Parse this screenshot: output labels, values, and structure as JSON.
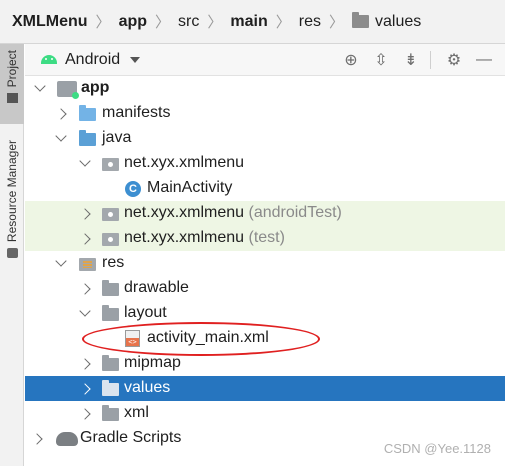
{
  "breadcrumb": {
    "items": [
      {
        "label": "XMLMenu",
        "bold": true
      },
      {
        "label": "app",
        "bold": true
      },
      {
        "label": "src",
        "bold": false
      },
      {
        "label": "main",
        "bold": true
      },
      {
        "label": "res",
        "bold": false
      },
      {
        "label": "values",
        "bold": false,
        "icon": "folder-icon"
      }
    ]
  },
  "side_strip": {
    "project_label": "Project",
    "resource_manager_label": "Resource Manager"
  },
  "toolbar": {
    "view_label": "Android",
    "buttons": [
      "locate-icon",
      "expand-all-icon",
      "collapse-all-icon",
      "gear-icon",
      "minimize-icon"
    ]
  },
  "tree": [
    {
      "label": "app",
      "bold": true,
      "expanded": true,
      "icon": "module-folder-icon"
    },
    {
      "label": "manifests",
      "expanded": false,
      "icon": "folder-icon"
    },
    {
      "label": "java",
      "expanded": true,
      "icon": "java-folder-icon"
    },
    {
      "label": "net.xyx.xmlmenu",
      "expanded": true,
      "icon": "package-icon"
    },
    {
      "label": "MainActivity",
      "icon": "class-icon"
    },
    {
      "label": "net.xyx.xmlmenu",
      "suffix": "(androidTest)",
      "expanded": false,
      "icon": "package-icon"
    },
    {
      "label": "net.xyx.xmlmenu",
      "suffix": "(test)",
      "expanded": false,
      "icon": "package-icon"
    },
    {
      "label": "res",
      "expanded": true,
      "icon": "res-folder-icon"
    },
    {
      "label": "drawable",
      "expanded": false,
      "icon": "folder-icon"
    },
    {
      "label": "layout",
      "expanded": true,
      "icon": "folder-icon"
    },
    {
      "label": "activity_main.xml",
      "icon": "xml-file-icon"
    },
    {
      "label": "mipmap",
      "expanded": false,
      "icon": "folder-icon"
    },
    {
      "label": "values",
      "expanded": false,
      "selected": true,
      "icon": "folder-icon"
    },
    {
      "label": "xml",
      "expanded": false,
      "icon": "folder-icon"
    },
    {
      "label": "Gradle Scripts",
      "expanded": false,
      "icon": "gradle-icon"
    }
  ],
  "colors": {
    "selection": "#2675bf",
    "test_row_bg": "#eef6e4",
    "highlight_oval": "#e02020"
  },
  "watermark": "CSDN @Yee.1128"
}
